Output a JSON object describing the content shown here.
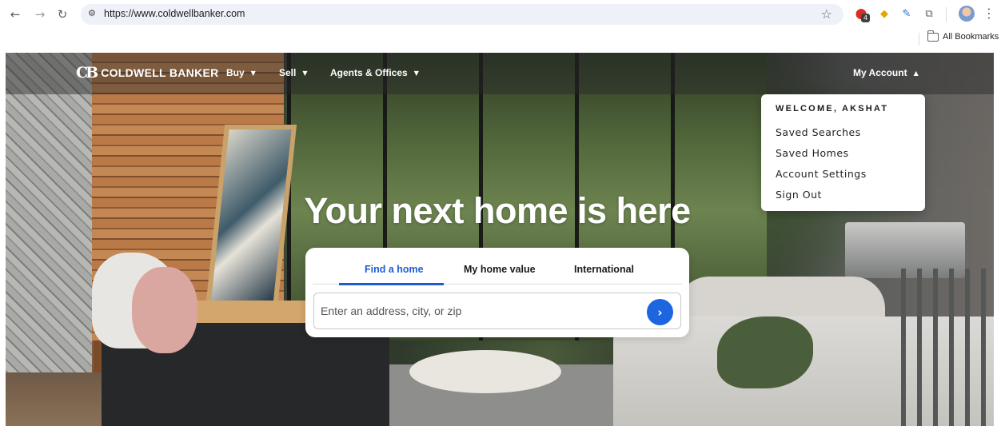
{
  "browser": {
    "url": "https://www.coldwellbanker.com",
    "bookmarks_label": "All Bookmarks",
    "extension_badge": "4",
    "icons": [
      "back-icon",
      "forward-icon",
      "reload-icon",
      "site-info-icon",
      "bookmark-star-icon",
      "extension-icon",
      "puzzle-icon",
      "profile-avatar",
      "kebab-menu-icon"
    ]
  },
  "header": {
    "logo_text": "COLDWELL BANKER",
    "nav": {
      "buy": "Buy",
      "sell": "Sell",
      "agents": "Agents & Offices",
      "account": "My Account"
    }
  },
  "account_menu": {
    "welcome": "WELCOME, AKSHAT",
    "items": [
      "Saved Searches",
      "Saved Homes",
      "Account Settings",
      "Sign Out"
    ]
  },
  "hero": {
    "title": "Your next home is here"
  },
  "search": {
    "tabs": [
      "Find a home",
      "My home value",
      "International"
    ],
    "active_tab": "Find a home",
    "placeholder": "Enter an address, city, or zip"
  },
  "colors": {
    "accent": "#1d66e0",
    "active_tab": "#1d5bd6",
    "omnibox": "#eef1f8"
  }
}
